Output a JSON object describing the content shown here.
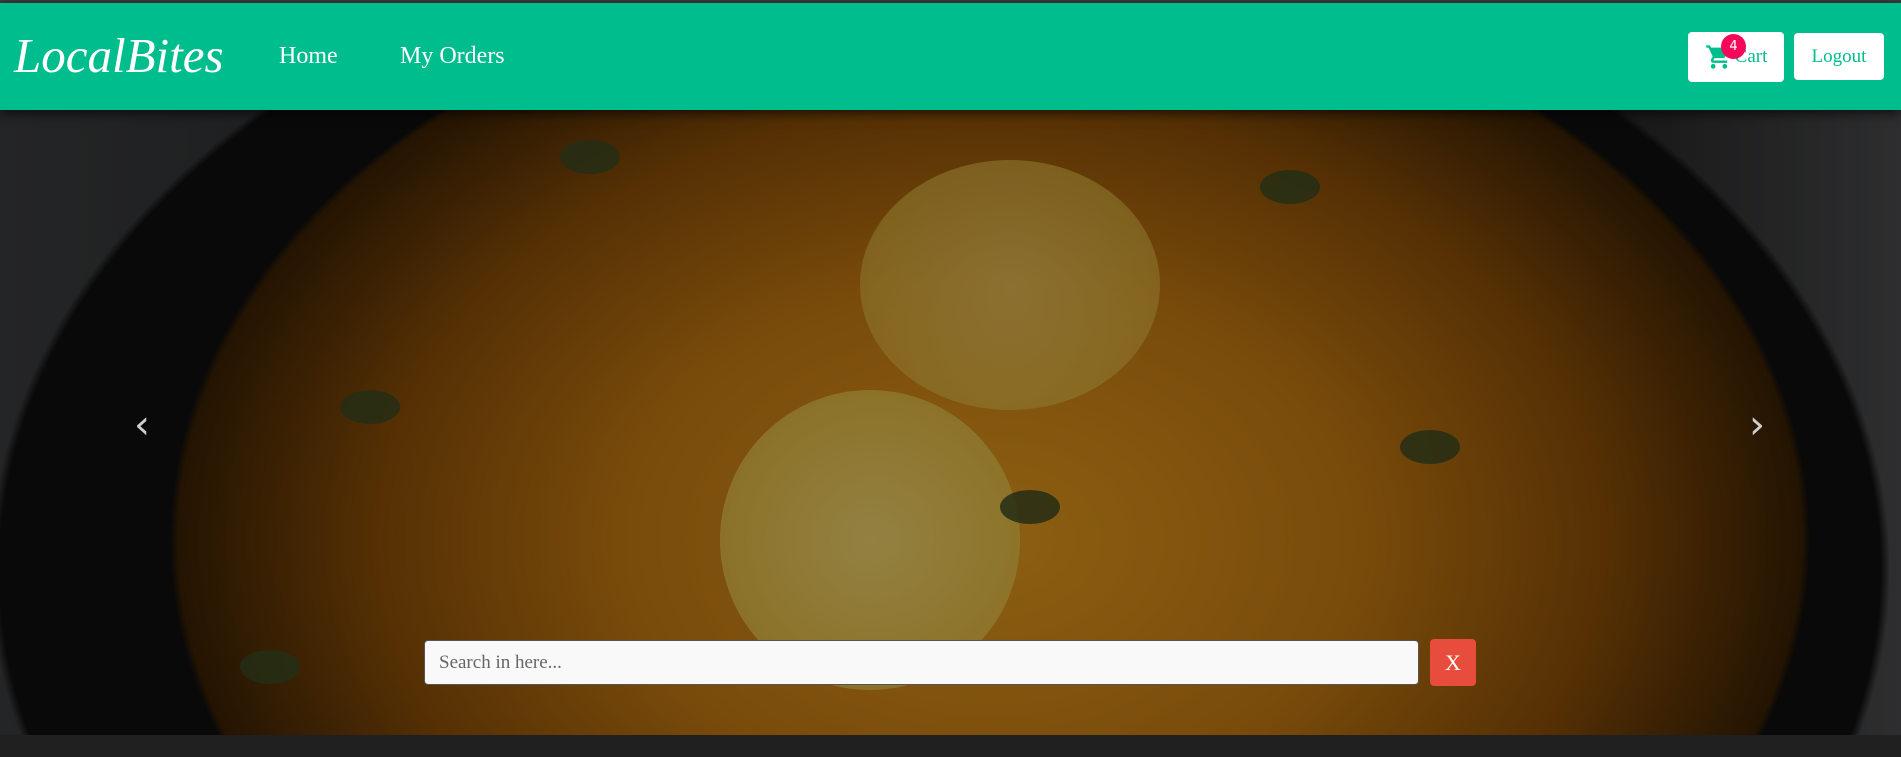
{
  "brand": {
    "name": "LocalBites",
    "color": "#00bd8d"
  },
  "nav": {
    "links": [
      {
        "label": "Home"
      },
      {
        "label": "My Orders"
      }
    ]
  },
  "actions": {
    "cart_label": "Cart",
    "cart_icon": "shopping-cart-icon",
    "cart_count": "4",
    "logout_label": "Logout"
  },
  "hero": {
    "prev_icon": "‹",
    "next_icon": "›"
  },
  "search": {
    "placeholder": "Search in here...",
    "value": "",
    "clear_label": "X"
  }
}
